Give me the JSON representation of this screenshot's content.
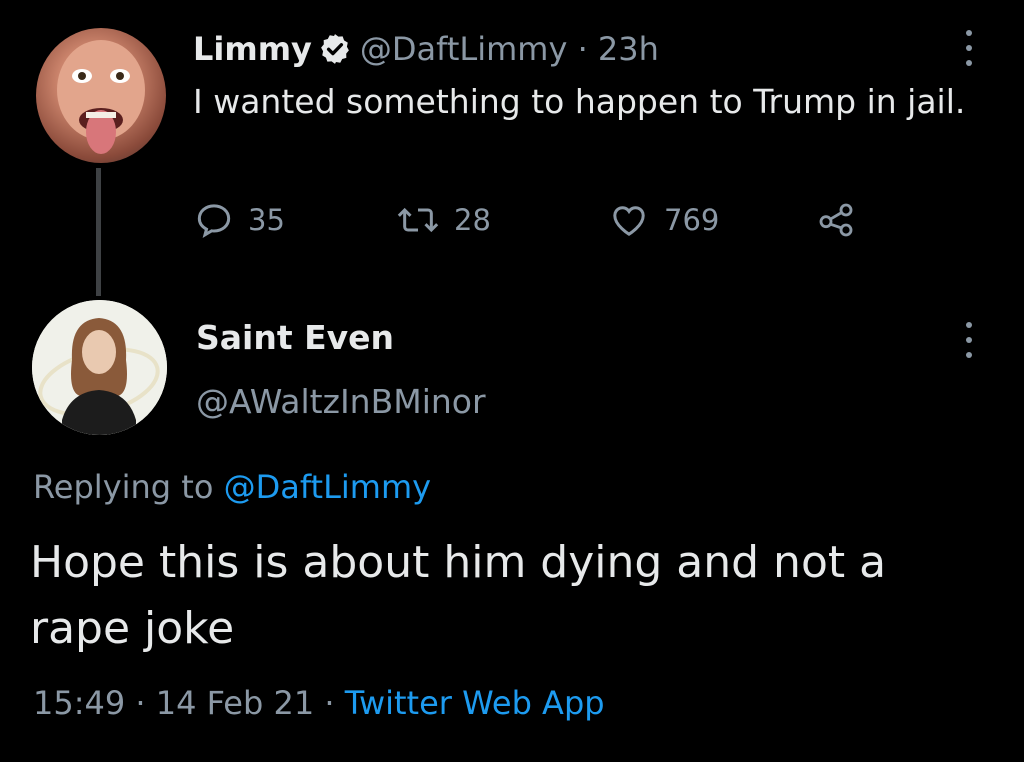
{
  "parent_tweet": {
    "display_name": "Limmy",
    "handle": "@DaftLimmy",
    "separator": " · ",
    "time": "23h",
    "text": "I wanted something to happen to Trump in jail.",
    "replies": "35",
    "retweets": "28",
    "likes": "769"
  },
  "reply_tweet": {
    "display_name": "Saint Even",
    "handle": "@AWaltzInBMinor",
    "replying_prefix": "Replying to ",
    "replying_to": "@DaftLimmy",
    "text": "Hope this is about him dying and not a rape joke",
    "time": "15:49",
    "separator": " · ",
    "date": "14 Feb 21",
    "separator2": " · ",
    "source": "Twitter Web App"
  },
  "colors": {
    "background": "#000000",
    "primary_text": "#e7e9ea",
    "secondary_text": "#8b98a5",
    "link": "#1d9bf0",
    "thread_line": "#3e4144"
  },
  "icons": {
    "verified": "verified-badge-icon",
    "more": "more-vertical-icon",
    "reply": "reply-icon",
    "retweet": "retweet-icon",
    "like": "heart-icon",
    "share": "share-icon"
  }
}
